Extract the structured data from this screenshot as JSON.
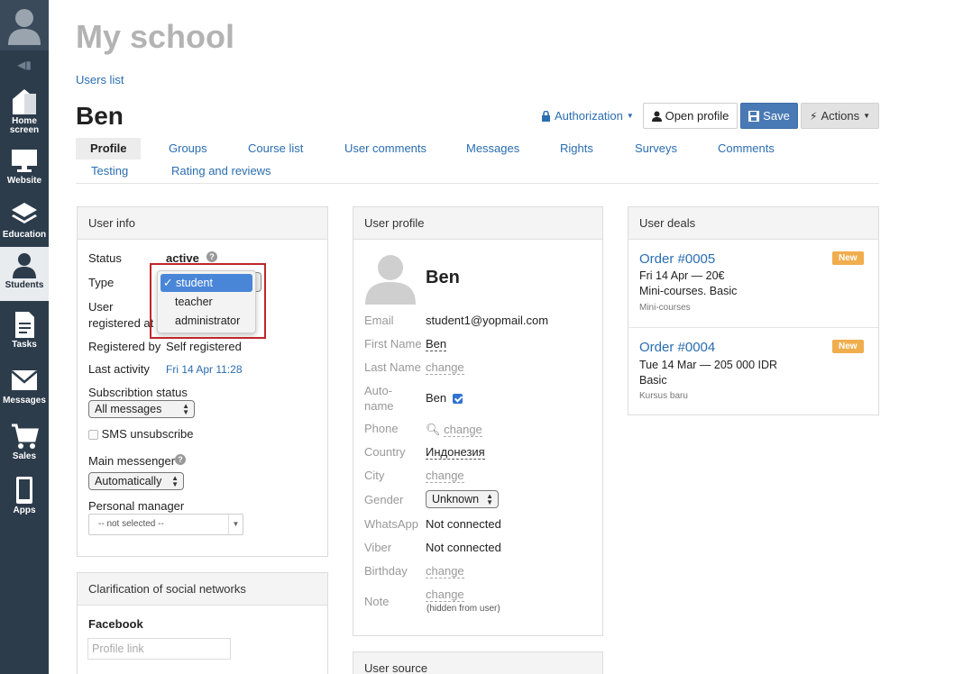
{
  "sidebar": {
    "items": [
      {
        "label": "Home screen",
        "icon": "home-icon"
      },
      {
        "label": "Website",
        "icon": "monitor-icon"
      },
      {
        "label": "Education",
        "icon": "layers-icon"
      },
      {
        "label": "Students",
        "icon": "user-icon"
      },
      {
        "label": "Tasks",
        "icon": "document-icon"
      },
      {
        "label": "Messages",
        "icon": "envelope-icon"
      },
      {
        "label": "Sales",
        "icon": "cart-icon"
      },
      {
        "label": "Apps",
        "icon": "phone-icon"
      }
    ]
  },
  "header": {
    "title": "My school",
    "breadcrumb": "Users list",
    "user_name": "Ben"
  },
  "toolbar": {
    "authorization_label": "Authorization",
    "open_profile_label": "Open profile",
    "save_label": "Save",
    "actions_label": "Actions"
  },
  "tabs": [
    {
      "label": "Profile"
    },
    {
      "label": "Groups"
    },
    {
      "label": "Course list"
    },
    {
      "label": "User comments"
    },
    {
      "label": "Messages"
    },
    {
      "label": "Rights"
    },
    {
      "label": "Surveys"
    },
    {
      "label": "Comments"
    },
    {
      "label": "Testing"
    },
    {
      "label": "Rating and reviews"
    }
  ],
  "user_info": {
    "title": "User info",
    "status_label": "Status",
    "status_value": "active",
    "type_label": "Type",
    "registered_at_label_1": "User",
    "registered_at_label_2": "registered at",
    "registered_by_label": "Registered by",
    "registered_by_value": "Self registered",
    "last_activity_label": "Last activity",
    "last_activity_value": "Fri 14 Apr 11:28",
    "subscription_label": "Subscribtion status",
    "subscription_value": "All messages",
    "sms_label": "SMS unsubscribe",
    "main_messenger_label": "Main messenger",
    "main_messenger_value": "Automatically",
    "personal_manager_label": "Personal manager",
    "personal_manager_value": "-- not selected --"
  },
  "type_dropdown": {
    "options": [
      "student",
      "teacher",
      "administrator"
    ],
    "selected": "student"
  },
  "social": {
    "title": "Clarification of social networks",
    "facebook_label": "Facebook",
    "profile_link_placeholder": "Profile link"
  },
  "user_profile": {
    "title": "User profile",
    "name": "Ben",
    "email_label": "Email",
    "email_value": "student1@yopmail.com",
    "first_name_label": "First Name",
    "first_name_value": "Ben",
    "last_name_label": "Last Name",
    "last_name_value": "change",
    "auto_name_label_1": "Auto-",
    "auto_name_label_2": "name",
    "auto_name_value": "Ben",
    "phone_label": "Phone",
    "phone_value": "change",
    "country_label": "Country",
    "country_value": "Индонезия",
    "city_label": "City",
    "city_value": "change",
    "gender_label": "Gender",
    "gender_value": "Unknown",
    "whatsapp_label": "WhatsApp",
    "whatsapp_value": "Not connected",
    "viber_label": "Viber",
    "viber_value": "Not connected",
    "birthday_label": "Birthday",
    "birthday_value": "change",
    "note_label": "Note",
    "note_value": "change",
    "note_hint": "(hidden from user)"
  },
  "user_source": {
    "title": "User source"
  },
  "user_deals": {
    "title": "User deals",
    "deals": [
      {
        "order": "Order #0005",
        "badge": "New",
        "date_price": "Fri 14 Apr — 20€",
        "product": "Mini-courses. Basic",
        "category": "Mini-courses"
      },
      {
        "order": "Order #0004",
        "badge": "New",
        "date_price": "Tue 14 Mar — 205 000 IDR",
        "product": "Basic",
        "category": "Kursus baru"
      }
    ]
  },
  "colors": {
    "sidebar": "#2d3c4b",
    "link": "#2a6db0",
    "save_button": "#4a7ab5",
    "badge": "#f0ad4e",
    "highlight": "#c0262c"
  }
}
